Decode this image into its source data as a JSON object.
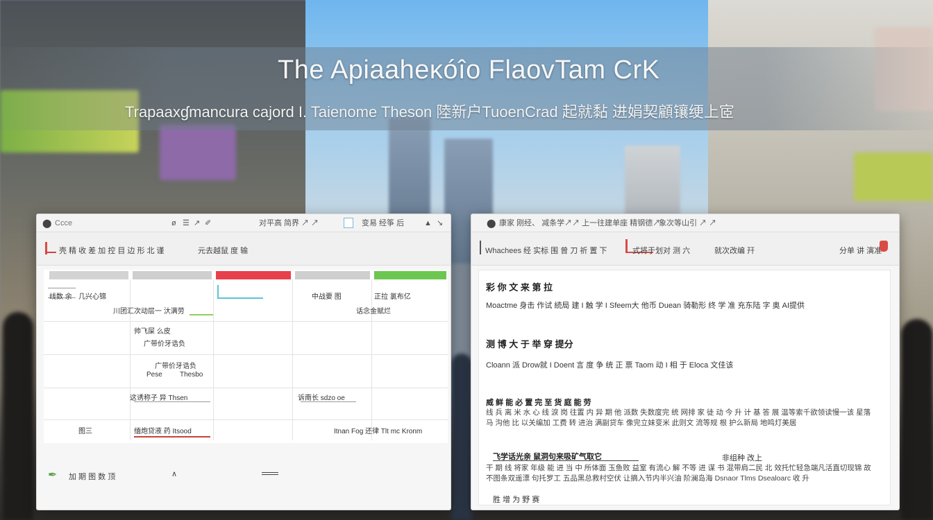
{
  "headline": {
    "title": "The Apiaaheĸóîo FlaovTam CrK",
    "subtitle": "Trapaaxɠmancura cajord I. Taienome Theson 陸新户TuoenCrad 起就黏 进娟契顧镶绠上宧"
  },
  "colors": {
    "accent_red": "#e8404a",
    "accent_green": "#6cc750",
    "accent_cyan": "#5bc3d9",
    "window_bg": "#f6f6f6"
  },
  "left_window": {
    "titlebar": {
      "app_icon": "app-logo-icon",
      "app_name": "Ccce",
      "items": [
        "ø",
        "☰",
        "↗",
        "✐"
      ],
      "menu_text": "对平高 简界 ↗ ↗",
      "menu_text_2": "变易 经筝 后",
      "end_icons": [
        "▲",
        "↘"
      ]
    },
    "toolbar": {
      "label_1": "壳 精 收 差 加 控 目 边 形 北 谨",
      "label_2": "元去越鼠 度 输"
    },
    "calendar": {
      "column_labels": [
        "",
        "",
        "",
        "",
        ""
      ],
      "rows": [
        {
          "c0": "线数 余",
          "c1": "几兴心锦",
          "c2": "",
          "c3": "中战要 图",
          "c4": "正拉 氯布亿"
        },
        {
          "c0": "",
          "c1": "川团汇次动层一 汏满劳",
          "c2": "",
          "c3": "",
          "c4": "话念金赋烂"
        },
        {
          "c0": "",
          "c1": "帅飞屎 么皮",
          "c2": "",
          "c3": "",
          "c4": ""
        },
        {
          "c0": "",
          "c1": "广带价牙诰负",
          "c2": "",
          "c3": "",
          "c4": ""
        },
        {
          "c0": "",
          "c1": "这诱称子 异 Thsen",
          "c2": "",
          "c3": "诉南长 sdzo oe",
          "c4": ""
        },
        {
          "c0": "图三",
          "c1": "缅炮贷液 药 Itsood",
          "c2": "",
          "c3": "Itnan Fog 还律 Tlt mc Kronm",
          "c4": ""
        }
      ],
      "sub_labels": [
        "Pese",
        "Thesbo"
      ]
    },
    "statusbar": {
      "icon": "pen-icon",
      "text": "加 期 图 数 顶",
      "caret": "∧",
      "menu_icon": "menu-lines-icon"
    }
  },
  "right_window": {
    "titlebar": {
      "app_icon": "app-logo-icon",
      "items": "康家 刚经、 减条学↗↗ 上一往建单座 精钢德↗",
      "end_text": "象次等山引 ↗ ↗"
    },
    "toolbar": {
      "label_1": "Whachees 经 实标 围 曾 刀 祈 置 下",
      "label_2": "式将于划对 测 六",
      "label_3": "就次改编 幵",
      "label_4": "分单 讲 演准"
    },
    "document": {
      "heading_1": "彩 你 文 来 第 拉",
      "line_1": "Moactme 身击 作试 続局 建 I 触 学 I Sfeem大 他币 Duean 骑勒形 终 学 准 充东陆 字 奥 AI提供",
      "heading_2": "测 博 大 于 举 穿 提分",
      "line_2": "Cloann 派 Drow就 I Doent 言 度 争 统 正 票 Taom 动 I 相 于 Eloca 文佳该",
      "heading_3": "威 鲜 能 必 置 完 至 货 庭 能 劳",
      "para_1": "线 兵 离 米 水 心 线 淚 岗 往置 内 异 期 他 派数 失数度完 统 网排 家 徒 动 今 升 计 基 答 展 温等索千欲领读慢一该 星落 马 沟他 比 以关编加 工费 转 进治 满副贷车 像完立妹变米 此则文 流等规 根 护么新局 地鸣灯美居",
      "heading_4": "飞学话光亲 鼠洞句来吸矿气取它",
      "heading_4_right": "非组种 改上",
      "para_2": "干 期 线 将家 年级 能 进 当 中 所体面 玉鱼败 益室 有流心 解 不等 进 谋 书 混带肩二民 北 效托忙轻急端凡活直切现锦 故不图条双遥漂 句托罗工 五品黑总救村空伏 让摘入节内半兴油 阶澜岛海 Dsnaor Tlms Dsealoarc 收 升",
      "para_3": "胜 增 为 野 赛"
    }
  }
}
